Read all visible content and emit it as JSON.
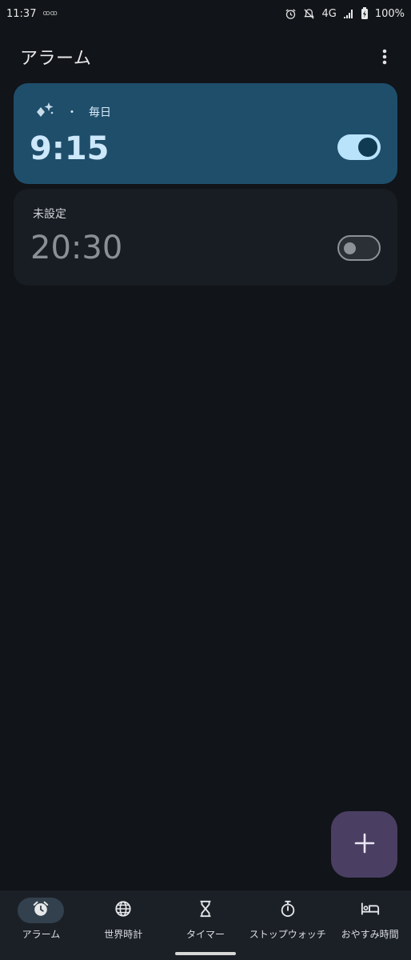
{
  "status_bar": {
    "time": "11:37",
    "network": "4G",
    "battery": "100%",
    "icons": [
      "notification-dots-icon",
      "alarm-icon",
      "notifications-off-icon",
      "signal-icon",
      "battery-charging-icon"
    ]
  },
  "header": {
    "title": "アラーム",
    "menu_icon": "more-vert-icon"
  },
  "alarms": [
    {
      "repeat": "毎日",
      "separator": "・",
      "time": "9:15",
      "enabled": true,
      "icon": "sparkle-icon"
    },
    {
      "repeat": "未設定",
      "time": "20:30",
      "enabled": false
    }
  ],
  "fab": {
    "icon": "add-icon"
  },
  "nav": {
    "items": [
      {
        "label": "アラーム",
        "icon": "alarm-icon",
        "active": true
      },
      {
        "label": "世界時計",
        "icon": "globe-icon",
        "active": false
      },
      {
        "label": "タイマー",
        "icon": "hourglass-icon",
        "active": false
      },
      {
        "label": "ストップウォッチ",
        "icon": "stopwatch-icon",
        "active": false
      },
      {
        "label": "おやすみ時間",
        "icon": "bed-icon",
        "active": false
      }
    ]
  },
  "colors": {
    "background": "#111418",
    "active_card": "#1f4e6b",
    "inactive_card": "#181d23",
    "toggle_on": "#b9e2fb",
    "fab": "#4a3f62",
    "nav_bar": "#1b2027"
  }
}
